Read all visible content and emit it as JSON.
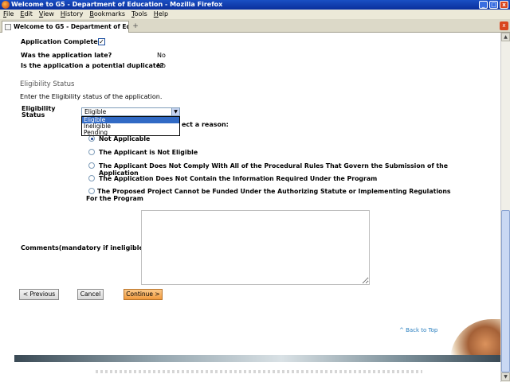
{
  "window": {
    "title": "Welcome to G5 - Department of Education - Mozilla Firefox",
    "minimize": "_",
    "maximize": "□",
    "close": "x"
  },
  "menu": [
    "File",
    "Edit",
    "View",
    "History",
    "Bookmarks",
    "Tools",
    "Help"
  ],
  "tab": {
    "label": "Welcome to G5 - Department of Edu...",
    "new_tab": "+",
    "close": "x"
  },
  "application": {
    "complete_label": "Application Complete",
    "complete_checked": "✓",
    "late_label": "Was the application late?",
    "late_value": "No",
    "duplicate_label": "Is the application a potential duplicate?",
    "duplicate_value": "No"
  },
  "eligibility": {
    "section_title": "Eligibility Status",
    "instructions": "Enter the Eligibility status of the application.",
    "field_label_line1": "Eligibility",
    "field_label_line2": "Status",
    "selected": "Eligible",
    "options": [
      "Eligible",
      "Ineligible",
      "Pending"
    ],
    "reason_prompt_partial": "ect a reason:",
    "reasons": [
      "Not Applicable",
      "The Applicant is Not Eligible",
      "The Applicant Does Not Comply With All of the Procedural Rules That Govern the Submission of the Application",
      "The Application Does Not Contain the Information Required Under the Program",
      "The Proposed Project Cannot be Funded Under the Authorizing Statute or Implementing Regulations For the Program"
    ],
    "selected_reason_index": 0
  },
  "comments": {
    "label": "Comments(mandatory if ineligible)",
    "value": ""
  },
  "buttons": {
    "previous": "< Previous",
    "cancel": "Cancel",
    "continue": "Continue >"
  },
  "back_to_top": "^ Back to Top",
  "colors": {
    "continue_button": "#f19a3e",
    "link": "#2a7fbf",
    "selection": "#316ac5"
  }
}
